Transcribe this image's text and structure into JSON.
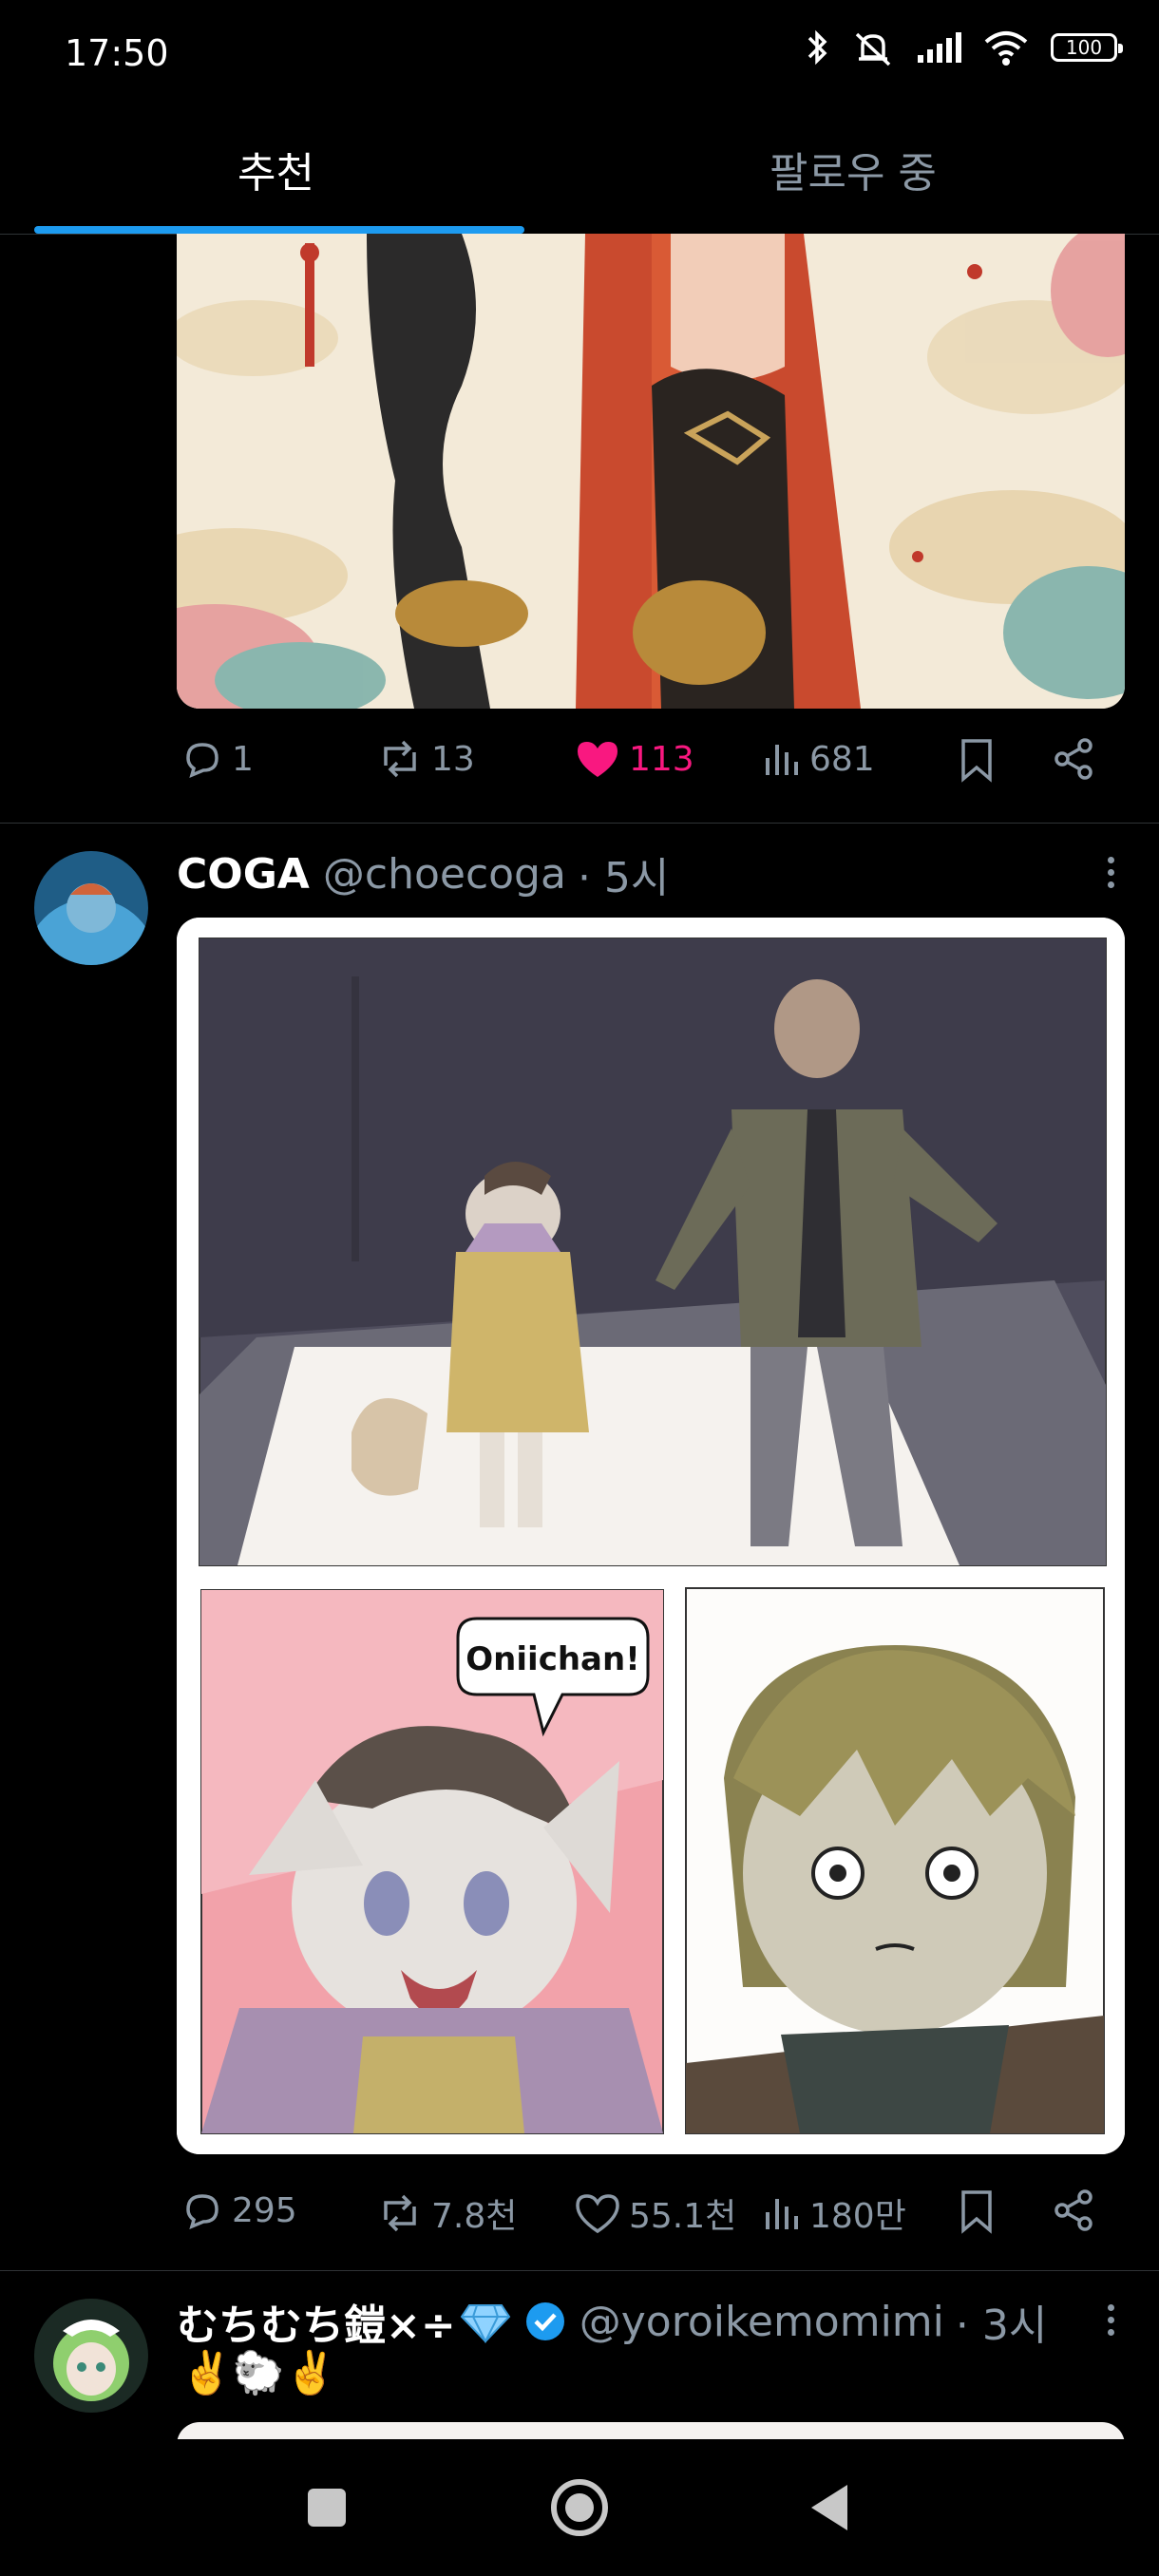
{
  "status_bar": {
    "time": "17:50",
    "battery": "100"
  },
  "tabs": [
    {
      "label": "추천",
      "active": true
    },
    {
      "label": "팔로우 중",
      "active": false
    }
  ],
  "post1": {
    "stats": {
      "replies": "1",
      "reposts": "13",
      "likes": "113",
      "views": "681",
      "liked": true
    }
  },
  "post2": {
    "name": "COGA",
    "handle": "@choecoga",
    "time": "· 5시",
    "comic_speech": "Oniichan!",
    "stats": {
      "replies": "295",
      "reposts": "7.8천",
      "likes": "55.1천",
      "views": "180만",
      "liked": false
    }
  },
  "post3": {
    "name": "むちむち鎧×÷",
    "handle": "@yoroikemomimi",
    "time": "· 3시",
    "verified": true,
    "text": "✌️🐑✌️"
  },
  "colors": {
    "accent": "#1d9bf0",
    "like": "#f91880",
    "muted": "#8b98a5"
  }
}
